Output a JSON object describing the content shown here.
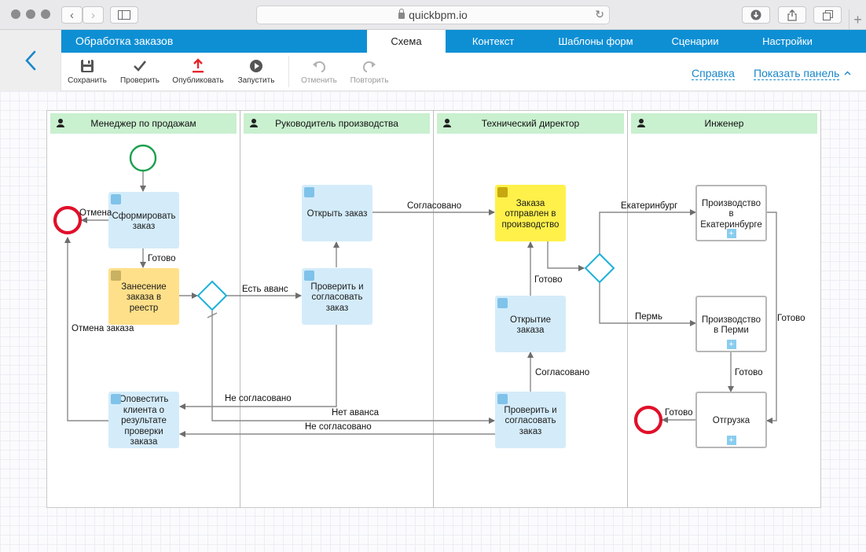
{
  "browser": {
    "url": "quickbpm.io"
  },
  "app": {
    "title": "Обработка заказов",
    "tabs": [
      {
        "label": "Схема",
        "active": true
      },
      {
        "label": "Контекст",
        "active": false
      },
      {
        "label": "Шаблоны форм",
        "active": false
      },
      {
        "label": "Сценарии",
        "active": false
      },
      {
        "label": "Настройки",
        "active": false
      }
    ],
    "accent": "#0e8fd4"
  },
  "toolbar": {
    "save": "Сохранить",
    "check": "Проверить",
    "publish": "Опубликовать",
    "run": "Запустить",
    "undo": "Отменить",
    "redo": "Повторить",
    "help": "Справка",
    "show_panel": "Показать панель"
  },
  "lanes": [
    {
      "name": "Менеджер по продажам"
    },
    {
      "name": "Руководитель производства"
    },
    {
      "name": "Технический директор"
    },
    {
      "name": "Инженер"
    }
  ],
  "tasks": {
    "form_order": "Сформировать заказ",
    "register_order": "Занесение заказа в реестр",
    "notify_client": "Оповестить клиента о результате проверки заказа",
    "open_order_1": "Открыть заказ",
    "check_agree_1": "Проверить и согласовать заказ",
    "order_sent": "Заказа отправлен в производство",
    "open_order_2": "Открытие заказа",
    "check_agree_2": "Проверить и согласовать заказ",
    "prod_ekb": "Производство в Екатеринбурге",
    "prod_perm": "Производство в Перми",
    "shipment": "Отгрузка"
  },
  "flow_labels": {
    "cancel": "Отмена",
    "ready_1": "Готово",
    "cancel_order": "Отмена заказа",
    "advance": "Есть аванс",
    "not_agreed_1": "Не согласовано",
    "no_advance": "Нет аванса",
    "not_agreed_2": "Не согласовано",
    "agreed_1": "Согласовано",
    "ready_2": "Готово",
    "agreed_2": "Согласовано",
    "ekb": "Екатеринбург",
    "perm": "Пермь",
    "ready_3": "Готово",
    "ready_4": "Готово",
    "ready_5": "Готово"
  },
  "colors": {
    "start_event": "#1a9f4e",
    "end_event": "#e0102a",
    "gateway": "#1bb0d9",
    "lane_header": "#c9f0cf"
  }
}
